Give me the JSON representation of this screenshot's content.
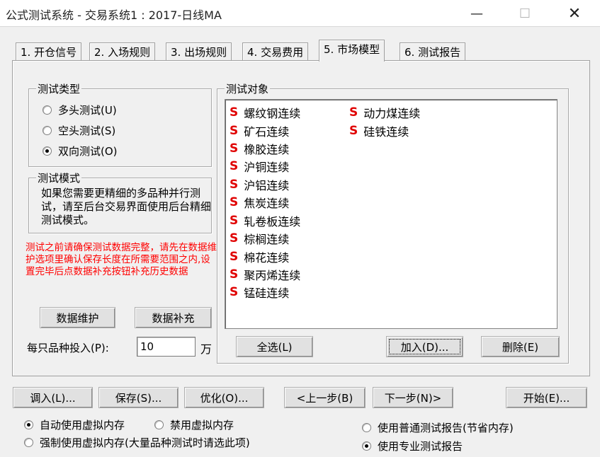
{
  "window": {
    "title": "公式测试系统 - 交易系统1 : 2017-日线MA",
    "controls": {
      "minimize": "—",
      "maximize": "☐",
      "close": "✕"
    }
  },
  "tabs": [
    {
      "label": "1. 开仓信号"
    },
    {
      "label": "2. 入场规则"
    },
    {
      "label": "3. 出场规则"
    },
    {
      "label": "4. 交易费用"
    },
    {
      "label": "5. 市场模型",
      "active": true
    },
    {
      "label": "6. 测试报告"
    }
  ],
  "test_type": {
    "title": "测试类型",
    "options": [
      {
        "label": "多头测试(U)",
        "selected": false
      },
      {
        "label": "空头测试(S)",
        "selected": false
      },
      {
        "label": "双向测试(O)",
        "selected": true
      }
    ]
  },
  "test_mode": {
    "title": "测试模式",
    "text": "如果您需要更精细的多品种并行测试，请至后台交易界面使用后台精细测试模式。"
  },
  "warning": {
    "text": "测试之前请确保测试数据完整，请先在数据维护选项里确认保存长度在所需要范围之内,设置完毕后点数据补充按钮补充历史数据",
    "color": "#ff0000"
  },
  "data_buttons": {
    "maintain": "数据维护",
    "supplement": "数据补充"
  },
  "investment": {
    "label": "每只品种投入(P):",
    "value": "10",
    "unit": "万"
  },
  "test_objects": {
    "title": "测试对象",
    "marker": "S",
    "marker_color": "#e00000",
    "column1": [
      "螺纹钢连续",
      "矿石连续",
      "橡胶连续",
      "沪铜连续",
      "沪铝连续",
      "焦炭连续",
      "轧卷板连续",
      "棕榈连续",
      "棉花连续",
      "聚丙烯连续",
      "锰硅连续"
    ],
    "column2": [
      "动力煤连续",
      "硅铁连续"
    ]
  },
  "list_buttons": {
    "select_all": "全选(L)",
    "add": "加入(D)...",
    "remove": "删除(E)"
  },
  "bottom_buttons": {
    "load": "调入(L)...",
    "save": "保存(S)...",
    "optimize": "优化(O)...",
    "prev": "<上一步(B)",
    "next": "下一步(N)>",
    "start": "开始(E)..."
  },
  "memory_options": [
    {
      "label": "自动使用虚拟内存",
      "selected": true
    },
    {
      "label": "禁用虚拟内存",
      "selected": false
    },
    {
      "label": "强制使用虚拟内存(大量品种测试时请选此项)",
      "selected": false
    }
  ],
  "report_options": [
    {
      "label": "使用普通测试报告(节省内存)",
      "selected": false
    },
    {
      "label": "使用专业测试报告",
      "selected": true
    }
  ]
}
